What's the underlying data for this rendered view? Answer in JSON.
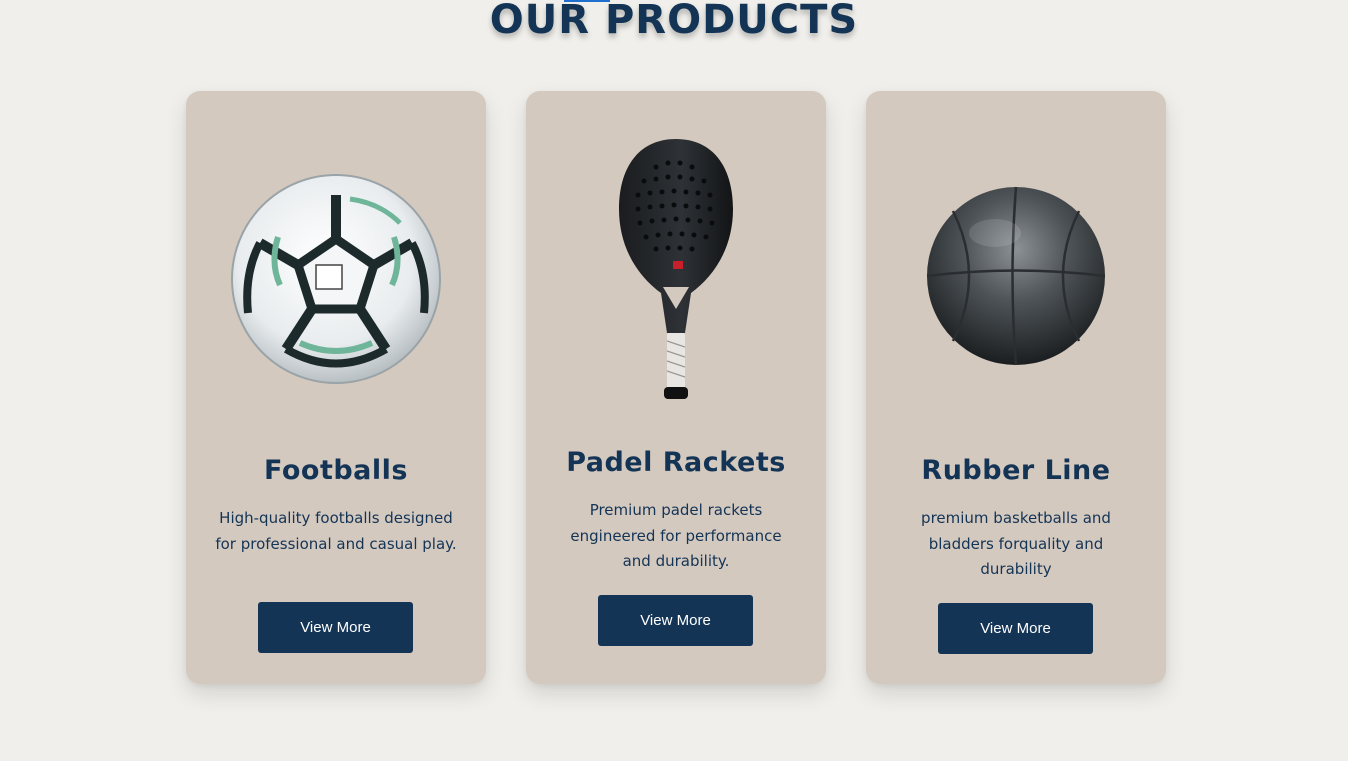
{
  "section": {
    "title": "OUR PRODUCTS"
  },
  "products": [
    {
      "name": "Footballs",
      "description": "High-quality footballs designed for professional and casual play.",
      "button_label": "View More",
      "image_icon": "football-icon"
    },
    {
      "name": "Padel Rackets",
      "description": "Premium padel rackets engineered for performance and durability.",
      "button_label": "View More",
      "image_icon": "padel-racket-icon"
    },
    {
      "name": "Rubber Line",
      "description": "premium basketballs and bladders forquality and durability",
      "button_label": "View More",
      "image_icon": "rubber-ball-icon"
    }
  ],
  "colors": {
    "background": "#f0efeb",
    "card": "#d4c9bf",
    "primary": "#143456",
    "accent": "#1f6fd1"
  }
}
